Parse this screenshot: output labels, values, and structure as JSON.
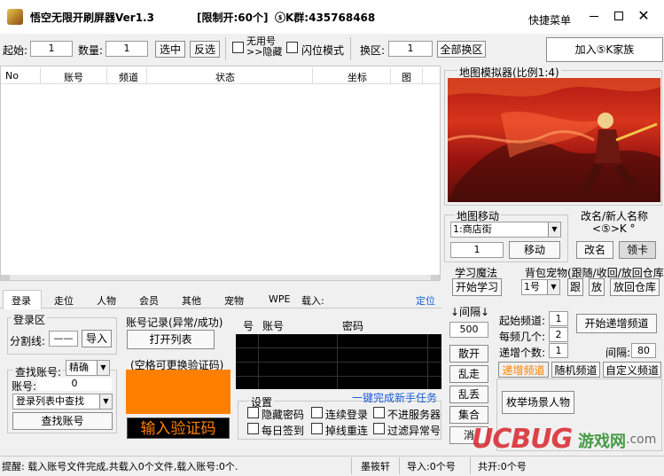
{
  "window": {
    "title": "悟空无限开刷屏器Ver1.3",
    "limit": "[限制开:60个]",
    "qq_group": "ⓢK群:435768468",
    "quick_menu": "快捷菜单"
  },
  "toolbar": {
    "start_label": "起始:",
    "start_value": "1",
    "count_label": "数量:",
    "count_value": "1",
    "select_btn": "选中",
    "invert_btn": "反选",
    "hide_useless_1": "无用号",
    "hide_useless_2": ">>隐藏",
    "flash_mode": "闪位模式",
    "switch_label": "换区:",
    "switch_value": "1",
    "switch_all_btn": "全部换区",
    "join_family_btn": "加入⑤K家族"
  },
  "table": {
    "columns": [
      "No",
      "账号",
      "频道",
      "状态",
      "坐标",
      "图"
    ]
  },
  "map_sim": {
    "title": "地图模拟器(比例1:4)"
  },
  "map_move": {
    "title": "地图移动",
    "location": "1:商店街",
    "value": "1",
    "move_btn": "移动"
  },
  "rename": {
    "title": "改名/新人名称",
    "name": "<⑤>K °",
    "rename_btn": "改名",
    "claim_btn": "领卡"
  },
  "learn": {
    "title": "学习魔法",
    "start_btn": "开始学习"
  },
  "pet": {
    "title": "背包宠物(跟随/收回/放回仓库",
    "slot": "1号",
    "follow_btn": "跟",
    "release_btn": "放",
    "return_btn": "放回仓库"
  },
  "interval": {
    "title": "↓间隔↓",
    "value": "500",
    "disperse_btn": "散开",
    "walk_btn": "乱走",
    "throw_btn": "乱丢",
    "gather_btn": "集合",
    "cancel_btn": "消"
  },
  "channel": {
    "start_label": "起始频道:",
    "start_value": "1",
    "per_label": "每频几个:",
    "per_value": "2",
    "inc_label": "递增个数:",
    "inc_value": "1",
    "start_btn": "开始递增频道",
    "interval_label": "间隔:",
    "interval_value": "80",
    "tabs": [
      "递增频道",
      "随机频道",
      "自定义频道"
    ],
    "scan_btn": "枚举场景人物"
  },
  "tabs": [
    "登录",
    "走位",
    "人物",
    "会员",
    "其他",
    "宠物",
    "WPE",
    "载入:",
    "定位"
  ],
  "login": {
    "area_title": "登录区",
    "split_label": "分割线:",
    "split_value": "——",
    "import_btn": "导入",
    "record_title": "账号记录(异常/成功)",
    "open_list_btn": "打开列表",
    "find_label": "查找账号:",
    "exact": "精确",
    "account_label": "账号:",
    "account_value": "0",
    "find_in_list": "登录列表中查找",
    "find_btn": "查找账号",
    "captcha_title": "(空格可更换验证码)",
    "captcha_btn": "输入验证码",
    "grid_cols": [
      "号",
      "账号",
      "密码"
    ],
    "settings_title": "设置",
    "newbie_link": "一键完成新手任务",
    "opts": [
      "隐藏密码",
      "连续登录",
      "不进服务器",
      "每日签到",
      "掉线重连",
      "过滤异常号"
    ]
  },
  "status": {
    "message": "提醒: 载入账号文件完成,共载入0个文件,载入账号:0个.",
    "author": "墨筱轩",
    "imported": "导入:0个号",
    "opened": "共开:0个号"
  },
  "watermark": {
    "text1": "UCBUG",
    "text2": "游戏网",
    "text3": ".com"
  },
  "colors": {
    "accent": "#1a5fd6",
    "captcha_bg": "#ff8000",
    "captcha_btn_bg": "#000000",
    "captcha_btn_text": "#ff8000",
    "watermark": "#d9252b"
  }
}
